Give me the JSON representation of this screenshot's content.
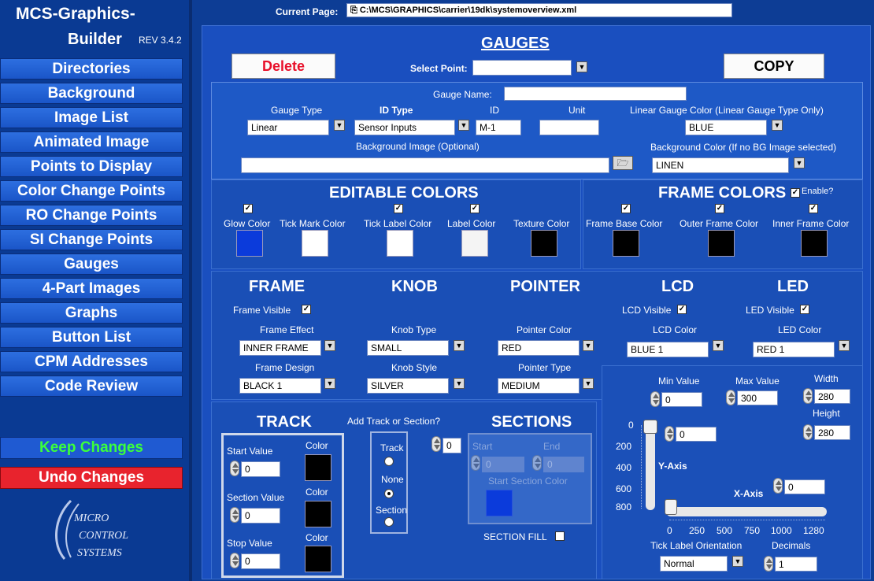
{
  "app": {
    "title_line1": "MCS-Graphics-",
    "title_line2": "Builder",
    "rev": "REV 3.4.2"
  },
  "sidebar": {
    "items": [
      {
        "label": "Directories"
      },
      {
        "label": "Background"
      },
      {
        "label": "Image List"
      },
      {
        "label": "Animated Image"
      },
      {
        "label": "Points to Display"
      },
      {
        "label": "Color Change Points"
      },
      {
        "label": "RO Change Points"
      },
      {
        "label": "SI Change Points"
      },
      {
        "label": "Gauges"
      },
      {
        "label": "4-Part Images"
      },
      {
        "label": "Graphs"
      },
      {
        "label": "Button List"
      },
      {
        "label": "CPM Addresses"
      },
      {
        "label": "Code Review"
      }
    ],
    "keep_changes": "Keep Changes",
    "undo_changes": "Undo Changes",
    "logo": {
      "line1": "MICRO",
      "line2": "CONTROL",
      "line3": "SYSTEMS"
    }
  },
  "header": {
    "current_page_label": "Current Page:",
    "current_page_value": "C:\\MCS\\GRAPHICS\\carrier\\19dk\\systemoverview.xml",
    "page_title": "GAUGES",
    "delete_label": "Delete",
    "select_point_label": "Select Point:",
    "copy_label": "COPY"
  },
  "gauge": {
    "gauge_name_label": "Gauge Name:",
    "gauge_type_label": "Gauge Type",
    "gauge_type_value": "Linear",
    "id_type_label": "ID Type",
    "id_type_value": "Sensor Inputs",
    "id_label": "ID",
    "id_value": "M-1",
    "unit_label": "Unit",
    "linear_color_label": "Linear Gauge Color (Linear Gauge Type Only)",
    "linear_color_value": "BLUE",
    "bg_image_label": "Background Image (Optional)",
    "bg_color_label": "Background Color (If no BG Image selected)",
    "bg_color_value": "LINEN"
  },
  "editable_colors": {
    "title": "EDITABLE COLORS",
    "items": [
      {
        "label": "Glow Color",
        "color": "#0b3bdb"
      },
      {
        "label": "Tick Mark Color",
        "color": "#ffffff"
      },
      {
        "label": "Tick Label Color",
        "color": "#ffffff"
      },
      {
        "label": "Label Color",
        "color": "#f4f4f4"
      },
      {
        "label": "Texture Color",
        "color": "#000000"
      }
    ]
  },
  "frame_colors": {
    "title": "FRAME COLORS",
    "enable_label": "Enable?",
    "items": [
      {
        "label": "Frame Base Color",
        "color": "#000000"
      },
      {
        "label": "Outer Frame Color",
        "color": "#000000"
      },
      {
        "label": "Inner Frame Color",
        "color": "#000000"
      }
    ]
  },
  "frame": {
    "title": "FRAME",
    "visible_label": "Frame Visible",
    "effect_label": "Frame Effect",
    "effect_value": "INNER FRAME",
    "design_label": "Frame Design",
    "design_value": "BLACK 1"
  },
  "knob": {
    "title": "KNOB",
    "type_label": "Knob Type",
    "type_value": "SMALL",
    "style_label": "Knob Style",
    "style_value": "SILVER"
  },
  "pointer": {
    "title": "POINTER",
    "color_label": "Pointer Color",
    "color_value": "RED",
    "type_label": "Pointer Type",
    "type_value": "MEDIUM"
  },
  "lcd": {
    "title": "LCD",
    "visible_label": "LCD Visible",
    "color_label": "LCD Color",
    "color_value": "BLUE 1"
  },
  "led": {
    "title": "LED",
    "visible_label": "LED Visible",
    "color_label": "LED Color",
    "color_value": "RED 1"
  },
  "track": {
    "title": "TRACK",
    "start_label": "Start Value",
    "start_value": "0",
    "section_label": "Section Value",
    "section_value": "0",
    "stop_label": "Stop Value",
    "stop_value": "0",
    "color_label": "Color"
  },
  "add_track": {
    "label": "Add Track or Section?",
    "count": "0",
    "opt_track": "Track",
    "opt_none": "None",
    "opt_section": "Section"
  },
  "sections": {
    "title": "SECTIONS",
    "start_label": "Start",
    "start_value": "0",
    "end_label": "End",
    "end_value": "0",
    "color_label": "Start Section Color",
    "fill_label": "SECTION FILL"
  },
  "preview": {
    "min_label": "Min Value",
    "min_value": "0",
    "max_label": "Max Value",
    "max_value": "300",
    "width_label": "Width",
    "width_value": "280",
    "height_label": "Height",
    "height_value": "280",
    "y_value": "0",
    "y_axis_label": "Y-Axis",
    "y_ticks": [
      "0",
      "200",
      "400",
      "600",
      "800"
    ],
    "x_axis_label": "X-Axis",
    "x_value": "0",
    "x_ticks": [
      "0",
      "250",
      "500",
      "750",
      "1000",
      "1280"
    ],
    "tick_orient_label": "Tick Label Orientation",
    "tick_orient_value": "Normal",
    "decimals_label": "Decimals",
    "decimals_value": "1"
  }
}
